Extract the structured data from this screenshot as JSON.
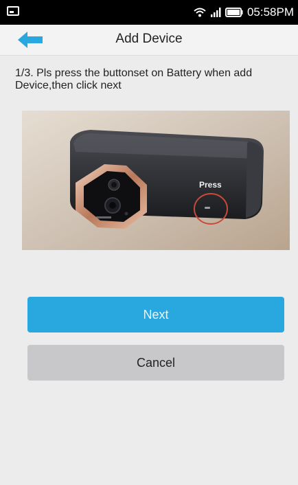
{
  "status_bar": {
    "time": "05:58PM",
    "icons": [
      "screenshot-notification-icon",
      "wifi-icon",
      "signal-icon",
      "battery-icon"
    ]
  },
  "header": {
    "title": "Add Device",
    "back_icon": "back-arrow-icon",
    "accent_color": "#29a8df"
  },
  "instruction": {
    "text": "1/3. Pls press the buttonset on Battery when add Device,then click next"
  },
  "photo": {
    "label_press": "Press"
  },
  "buttons": {
    "next_label": "Next",
    "cancel_label": "Cancel"
  }
}
